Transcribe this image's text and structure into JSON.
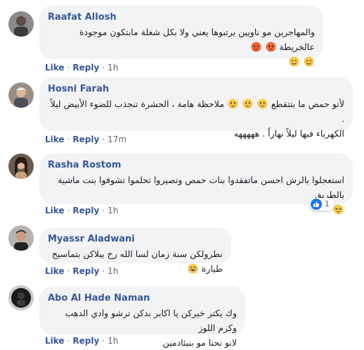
{
  "comments": [
    {
      "name": "Raafat Allosh",
      "text_line1": "والمهاجرين مو ناويين يرتبوها يعني ولا بكل شغلة مابتكون موجودة عالخريطة",
      "like_label": "Like",
      "reply_label": "Reply",
      "time": "1h"
    },
    {
      "name": "Hosni Farah",
      "text_line1": "ملاحظة هامة ، الحشرة تنجذب للضوء الأبيض ليلاً .",
      "text_line1b": "لأنو حمص ما بتتقطع",
      "text_line2": "الكهرباء فيها ليلاً نهاراً .  هههههه",
      "like_label": "Like",
      "reply_label": "Reply",
      "time": "17m"
    },
    {
      "name": "Rasha Rostom",
      "text_line1": "استعجلوا بالرش احسن ماتفقدوا بنات حمص وتصيروا تحلموا تشوفوا بنت ماشية بالطريق",
      "like_label": "Like",
      "reply_label": "Reply",
      "time": "1h",
      "reaction_count": "1"
    },
    {
      "name": "Myassr Aladwani",
      "text_line1": "نطرولكن سنة زمان لسا الله رح يبلاكن بتماسيح طيارة",
      "like_label": "Like",
      "reply_label": "Reply",
      "time": "1h"
    },
    {
      "name": "Abo Al Hade Naman",
      "text_line1": "وك يكتر خيركن يا اكابر بدكن ترشو وادي الدهب وكرم اللوز",
      "text_line2": "لانو نحنا مو بنيئادمين",
      "like_label": "Like",
      "reply_label": "Reply",
      "time": "1h"
    }
  ],
  "icons": {
    "angry": "angry-face-icon",
    "smile": "smiling-face-icon",
    "grin": "grinning-face-icon",
    "unamused": "unamused-face-icon",
    "tears": "tears-of-joy-face-icon",
    "like": "like-thumb-icon"
  },
  "colors": {
    "link": "#385898",
    "bubble": "#f2f3f5",
    "meta": "#606770",
    "like_blue": "#1877f2"
  }
}
